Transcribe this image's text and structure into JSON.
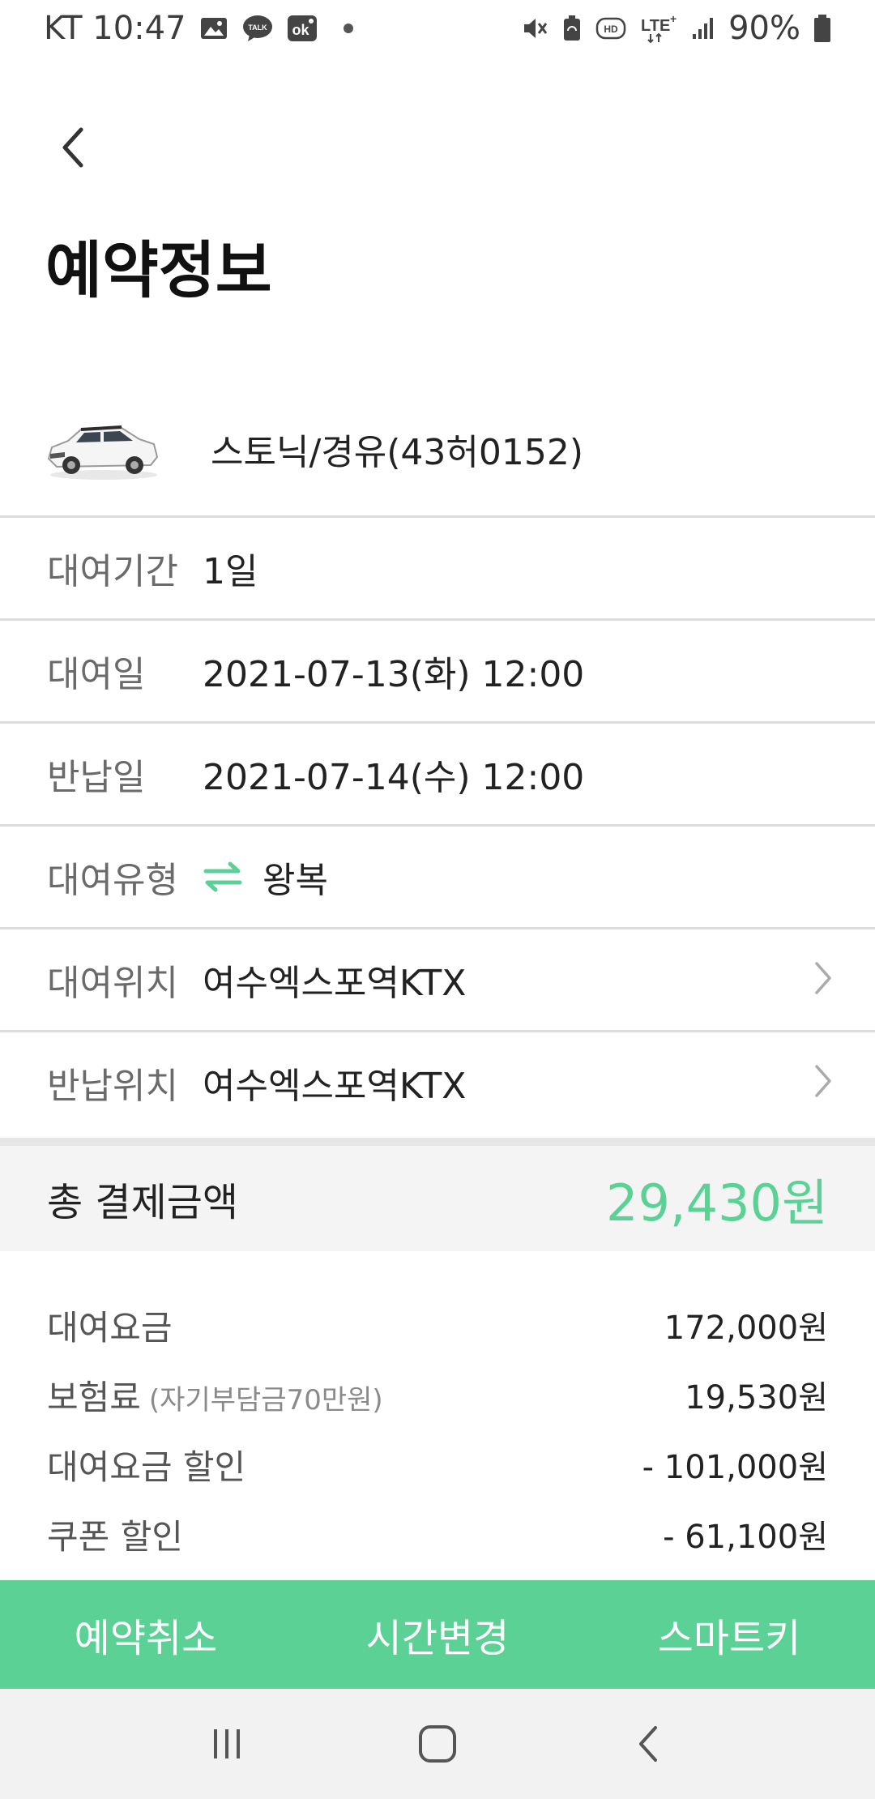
{
  "status_bar": {
    "carrier_time": "KT 10:47",
    "battery": "90%",
    "icons_left": [
      "gallery-icon",
      "talk-icon",
      "ok-icon",
      "dot-icon"
    ],
    "icons_right": [
      "mute-icon",
      "battery-saver-icon",
      "hd-icon",
      "lte-icon",
      "signal-icon",
      "battery-icon"
    ]
  },
  "header": {
    "back_icon": "chevron-left-icon",
    "title": "예약정보"
  },
  "car": {
    "name": "스토닉/경유(43허0152)"
  },
  "info_rows": [
    {
      "label": "대여기간",
      "value": "1일"
    },
    {
      "label": "대여일",
      "value": "2021-07-13(화) 12:00"
    },
    {
      "label": "반납일",
      "value": "2021-07-14(수) 12:00"
    },
    {
      "label": "대여유형",
      "value": "왕복",
      "icon": "swap-arrows-icon"
    },
    {
      "label": "대여위치",
      "value": "여수엑스포역KTX",
      "icon": "chevron-right-icon"
    },
    {
      "label": "반납위치",
      "value": "여수엑스포역KTX",
      "icon": "chevron-right-icon"
    }
  ],
  "total": {
    "label": "총 결제금액",
    "amount": "29,430원"
  },
  "breakdown": [
    {
      "label": "대여요금",
      "sub": "",
      "value": "172,000원"
    },
    {
      "label": "보험료",
      "sub": "(자기부담금70만원)",
      "value": "19,530원"
    },
    {
      "label": "대여요금 할인",
      "sub": "",
      "value": "- 101,000원"
    },
    {
      "label": "쿠폰 할인",
      "sub": "",
      "value": "- 61,100원"
    }
  ],
  "actions": {
    "cancel": "예약취소",
    "change_time": "시간변경",
    "smart_key": "스마트키"
  },
  "colors": {
    "accent": "#5bd196",
    "label_gray": "#6a6a6a",
    "divider": "#dcdcdc"
  },
  "nav_bar": {
    "icons": [
      "recent-apps-icon",
      "home-icon",
      "back-icon"
    ]
  }
}
